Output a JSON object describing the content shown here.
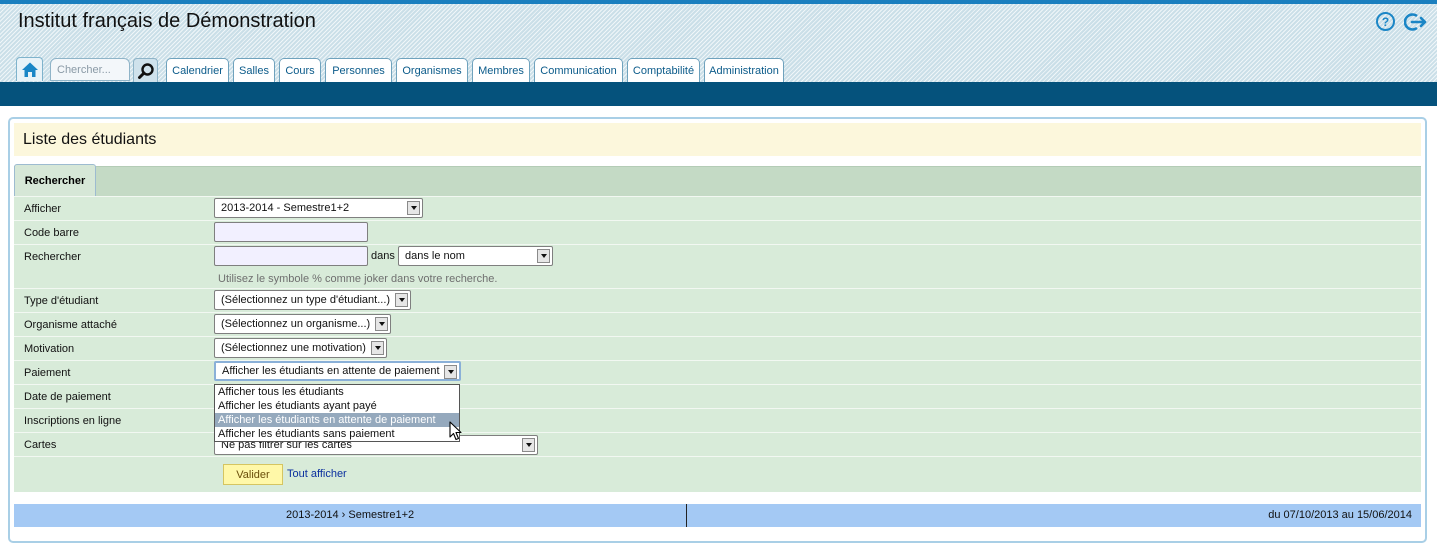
{
  "header": {
    "title": "Institut français de Démonstration",
    "search_placeholder": "Chercher...",
    "help_icon": "help-circle-icon",
    "logout_icon": "logout-icon",
    "home_icon": "home-icon",
    "search_icon": "magnifier-icon"
  },
  "nav": {
    "tabs": [
      "Calendrier",
      "Salles",
      "Cours",
      "Personnes",
      "Organismes",
      "Membres",
      "Communication",
      "Comptabilité",
      "Administration"
    ]
  },
  "page": {
    "title": "Liste des étudiants"
  },
  "form": {
    "section_tab": "Rechercher",
    "rows": {
      "afficher": {
        "label": "Afficher",
        "value": "2013-2014 - Semestre1+2"
      },
      "code_barre": {
        "label": "Code barre",
        "value": ""
      },
      "rechercher": {
        "label": "Rechercher",
        "value": "",
        "dans_label": "dans",
        "dans_value": "dans le nom",
        "hint": "Utilisez le symbole % comme joker dans votre recherche."
      },
      "type_etudiant": {
        "label": "Type d'étudiant",
        "value": "(Sélectionnez un type d'étudiant...)"
      },
      "organisme": {
        "label": "Organisme attaché",
        "value": "(Sélectionnez un organisme...)"
      },
      "motivation": {
        "label": "Motivation",
        "value": "(Sélectionnez une motivation)"
      },
      "paiement": {
        "label": "Paiement",
        "value": "Afficher les étudiants en attente de paiement",
        "options": [
          "Afficher tous les étudiants",
          "Afficher les étudiants ayant payé",
          "Afficher les étudiants en attente de paiement",
          "Afficher les étudiants sans paiement"
        ],
        "highlighted_option": "Afficher les étudiants en attente de paiement"
      },
      "date_paiement": {
        "label": "Date de paiement"
      },
      "inscriptions": {
        "label": "Inscriptions en ligne"
      },
      "cartes": {
        "label": "Cartes",
        "value": "Ne pas filtrer sur les cartes"
      }
    },
    "valider_label": "Valider",
    "tout_afficher_label": "Tout afficher"
  },
  "period": {
    "name": "2013-2014 › Semestre1+2",
    "dates": "du 07/10/2013 au 15/06/2014"
  },
  "colors": {
    "accent": "#1a7fbf",
    "navbar": "#05527c",
    "form_row": "#d8ebd9",
    "title_bar": "#fcf7dc",
    "period_bar": "#a4c9f4"
  }
}
